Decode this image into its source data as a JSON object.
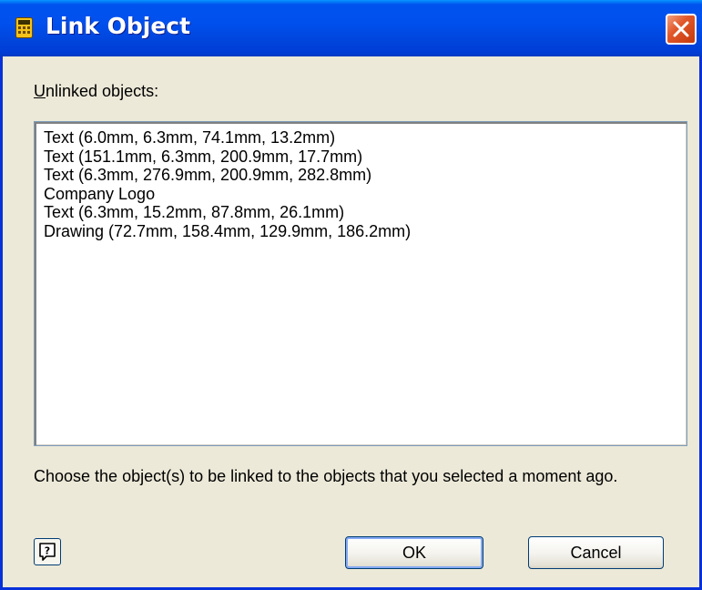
{
  "window": {
    "title": "Link Object"
  },
  "dialog": {
    "unlinked_label": "Unlinked objects:",
    "unlinked_label_mnemonic": "U",
    "unlinked_label_rest": "nlinked objects:",
    "objects": [
      "Text (6.0mm, 6.3mm, 74.1mm, 13.2mm)",
      "Text (151.1mm, 6.3mm, 200.9mm, 17.7mm)",
      "Text (6.3mm, 276.9mm, 200.9mm, 282.8mm)",
      "Company Logo",
      "Text (6.3mm, 15.2mm, 87.8mm, 26.1mm)",
      "Drawing (72.7mm, 158.4mm, 129.9mm, 186.2mm)"
    ],
    "description": "Choose the object(s) to be linked to the objects that you selected a moment ago."
  },
  "buttons": {
    "ok_label": "OK",
    "cancel_label": "Cancel"
  },
  "icons": {
    "title": "calculator-icon",
    "close": "close-icon",
    "help": "help-icon"
  },
  "colors": {
    "titlebar": "#0053ee",
    "close_button": "#e2582a",
    "dialog_background": "#ece9d8",
    "button_border": "#003c74"
  }
}
